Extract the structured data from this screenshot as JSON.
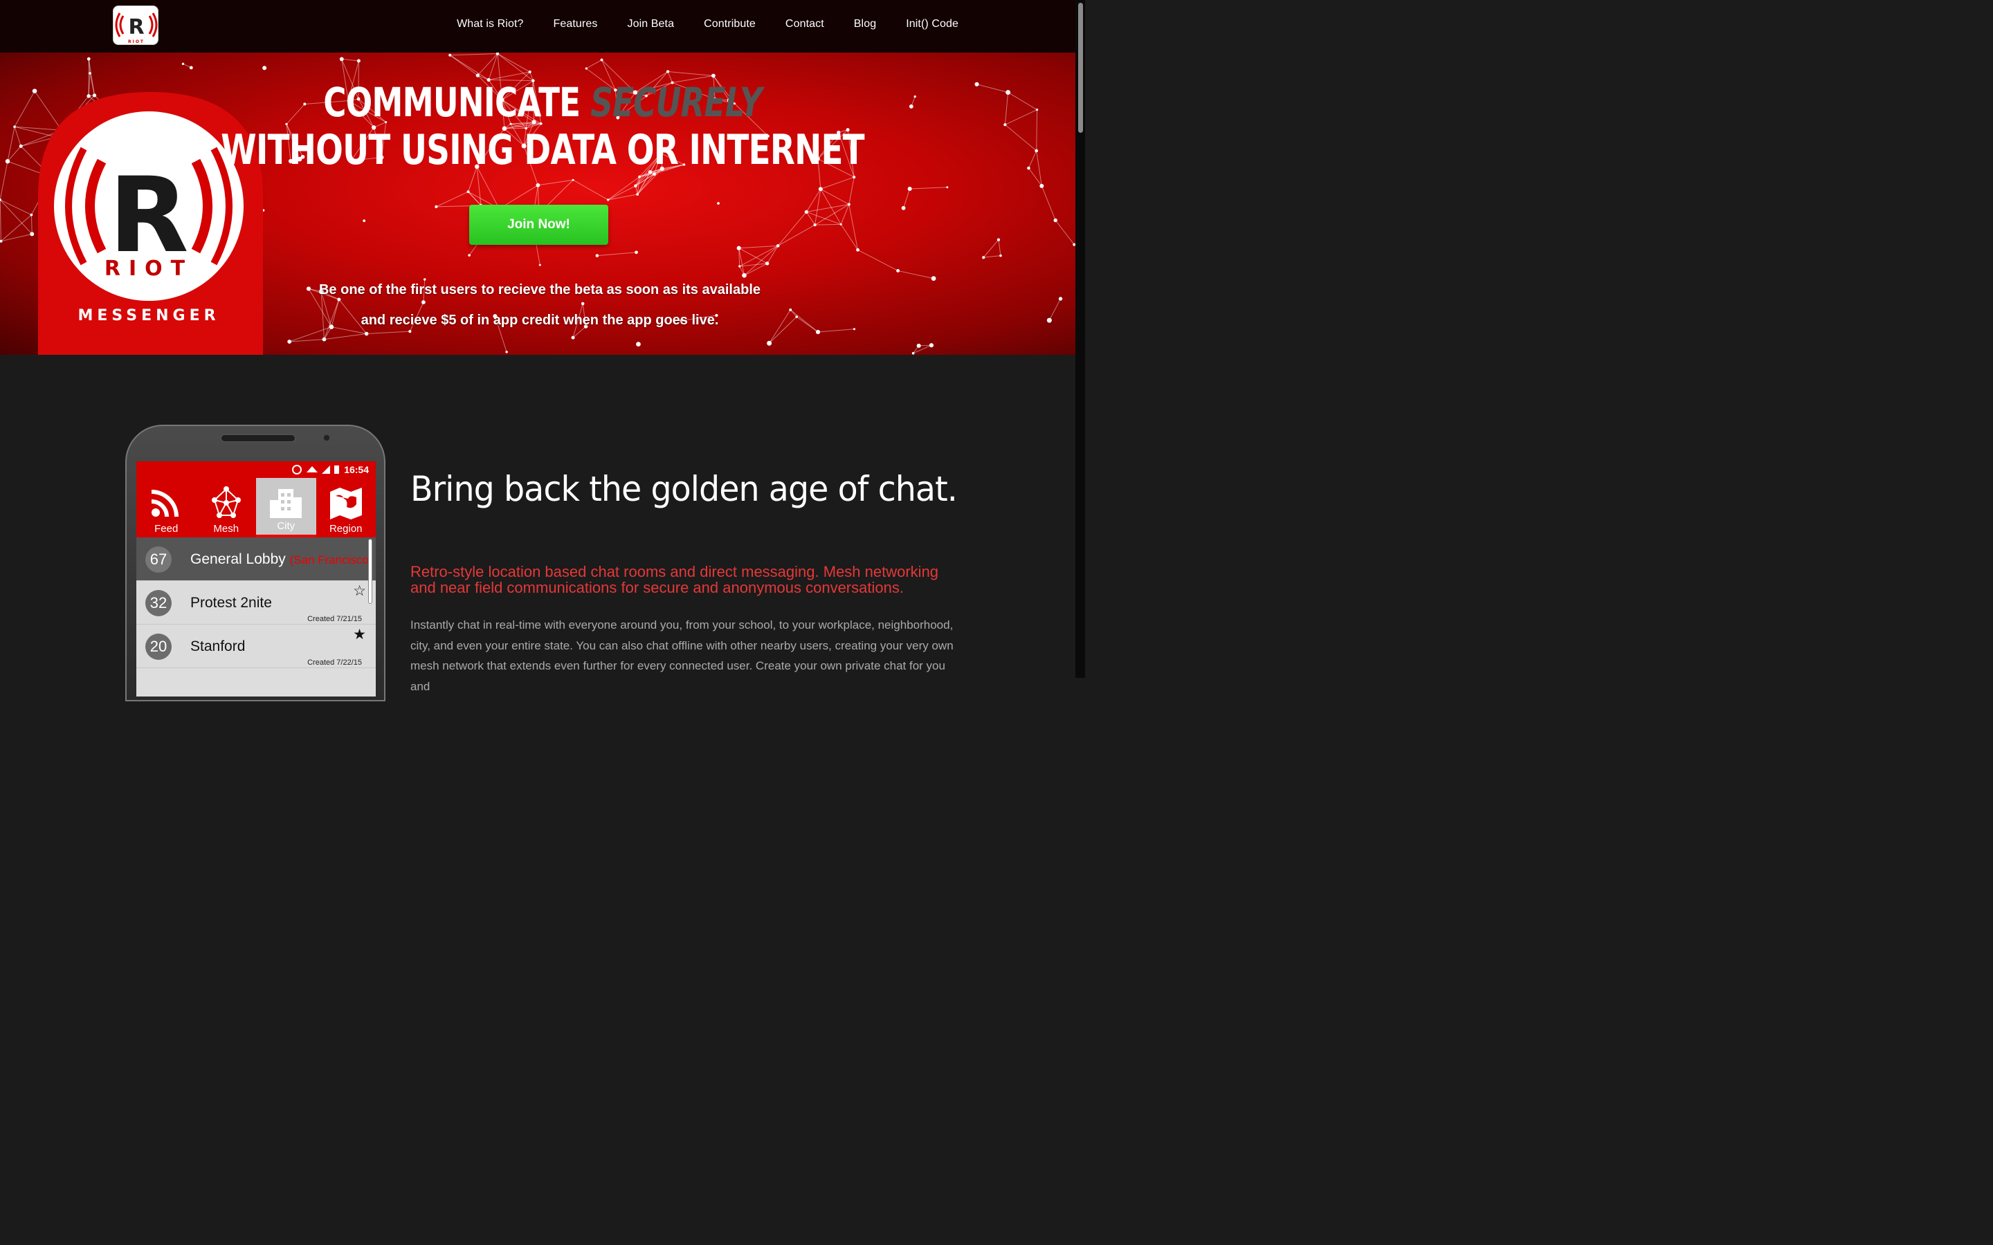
{
  "nav": {
    "logo_text": "R",
    "logo_caption": "RIOT",
    "links": [
      "What is Riot?",
      "Features",
      "Join Beta",
      "Contribute",
      "Contact",
      "Blog",
      "Init() Code"
    ]
  },
  "hero": {
    "title_part1": "COMMUNICATE",
    "title_accent": "SECURELY",
    "title_line2": "WITHOUT USING DATA OR INTERNET",
    "button_label": "Join Now!",
    "subtitle_line1": "Be one of the first users to recieve the beta as soon as its available",
    "subtitle_line2": "and recieve $5 of in app credit when the app goes live.",
    "badge_letter": "R",
    "badge_name": "RIOT",
    "badge_caption": "MESSENGER"
  },
  "section": {
    "heading": "Bring back the golden age of chat.",
    "lead": "Retro-style location based chat rooms and direct messaging. Mesh networking and near field communications for secure and anonymous conversations.",
    "body": "Instantly chat in real-time with everyone around you, from your school, to your workplace, neighborhood, city, and even your entire state. You can also chat offline with other nearby users, creating your very own mesh network that extends even further for every connected user. Create your own private chat for you and"
  },
  "phone": {
    "time": "16:54",
    "tabs": [
      "Feed",
      "Mesh",
      "City",
      "Region"
    ],
    "active_tab": "City",
    "rooms": [
      {
        "count": "67",
        "name": "General Lobby",
        "location": "(San Francisco)",
        "created": "",
        "star": ""
      },
      {
        "count": "32",
        "name": "Protest 2nite",
        "location": "",
        "created": "Created 7/21/15",
        "star": "☆"
      },
      {
        "count": "20",
        "name": "Stanford",
        "location": "",
        "created": "Created 7/22/15",
        "star": "★"
      }
    ]
  },
  "colors": {
    "brand_red": "#d50000",
    "accent_text_red": "#e53838",
    "cta_green": "#33d42a",
    "background": "#1b1b1b"
  }
}
